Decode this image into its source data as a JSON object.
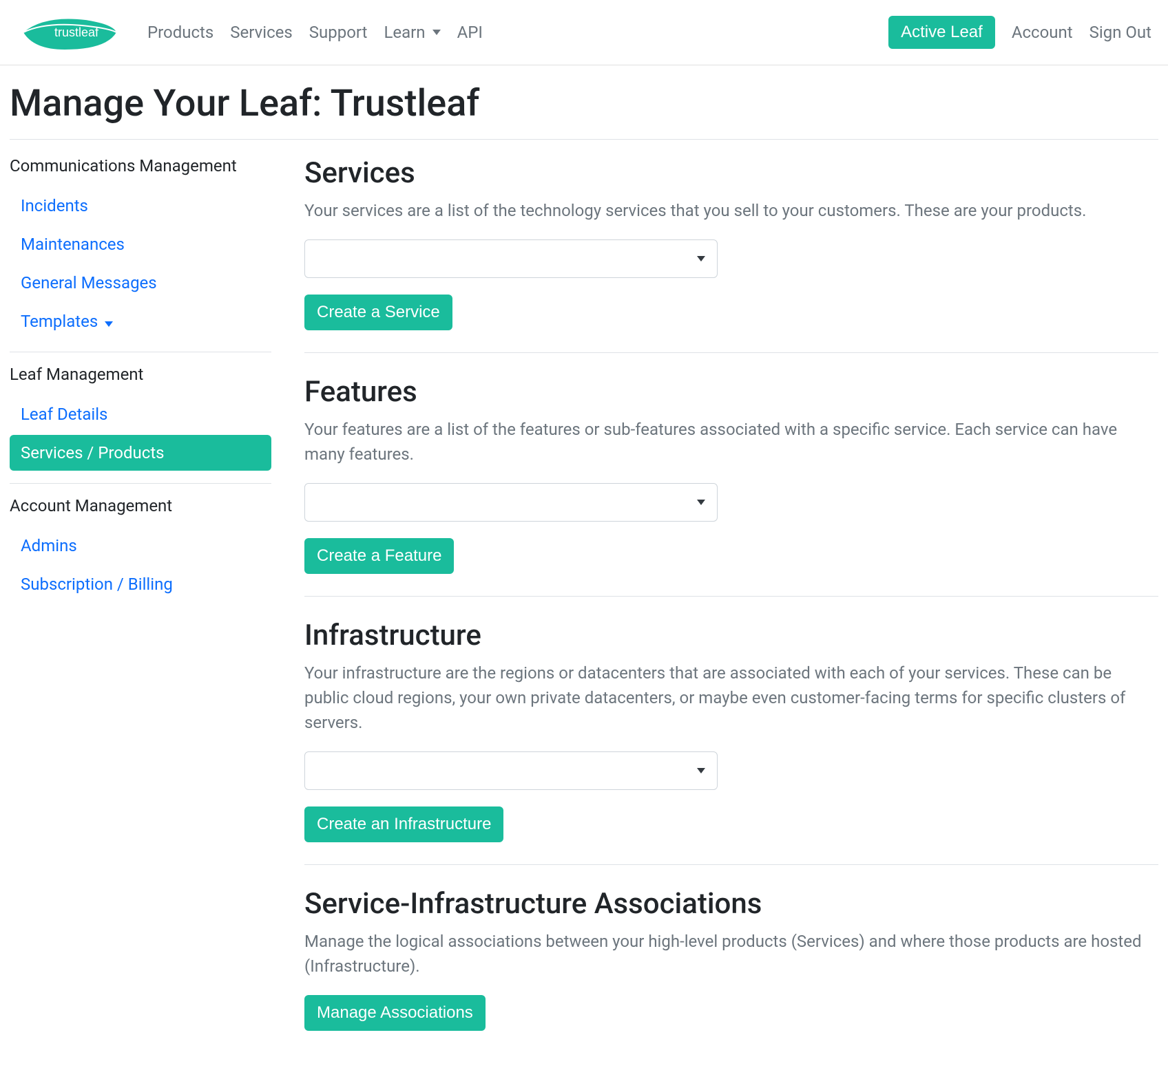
{
  "brand": "trustleaf",
  "nav": {
    "links": [
      "Products",
      "Services",
      "Support",
      "Learn",
      "API"
    ],
    "right": {
      "active_leaf": "Active Leaf",
      "account": "Account",
      "sign_out": "Sign Out"
    }
  },
  "page_title": "Manage Your Leaf: Trustleaf",
  "sidebar": {
    "groups": [
      {
        "title": "Communications Management",
        "items": [
          {
            "label": "Incidents",
            "active": false,
            "has_caret": false
          },
          {
            "label": "Maintenances",
            "active": false,
            "has_caret": false
          },
          {
            "label": "General Messages",
            "active": false,
            "has_caret": false
          },
          {
            "label": "Templates",
            "active": false,
            "has_caret": true
          }
        ]
      },
      {
        "title": "Leaf Management",
        "items": [
          {
            "label": "Leaf Details",
            "active": false,
            "has_caret": false
          },
          {
            "label": "Services / Products",
            "active": true,
            "has_caret": false
          }
        ]
      },
      {
        "title": "Account Management",
        "items": [
          {
            "label": "Admins",
            "active": false,
            "has_caret": false
          },
          {
            "label": "Subscription / Billing",
            "active": false,
            "has_caret": false
          }
        ]
      }
    ]
  },
  "sections": {
    "services": {
      "title": "Services",
      "desc": "Your services are a list of the technology services that you sell to your customers. These are your products.",
      "button": "Create a Service"
    },
    "features": {
      "title": "Features",
      "desc": "Your features are a list of the features or sub-features associated with a specific service. Each service can have many features.",
      "button": "Create a Feature"
    },
    "infrastructure": {
      "title": "Infrastructure",
      "desc": "Your infrastructure are the regions or datacenters that are associated with each of your services. These can be public cloud regions, your own private datacenters, or maybe even customer-facing terms for specific clusters of servers.",
      "button": "Create an Infrastructure"
    },
    "associations": {
      "title": "Service-Infrastructure Associations",
      "desc": "Manage the logical associations between your high-level products (Services) and where those products are hosted (Infrastructure).",
      "button": "Manage Associations"
    }
  },
  "colors": {
    "accent": "#1abc9c",
    "link": "#0d6efd",
    "muted": "#6c757d"
  }
}
